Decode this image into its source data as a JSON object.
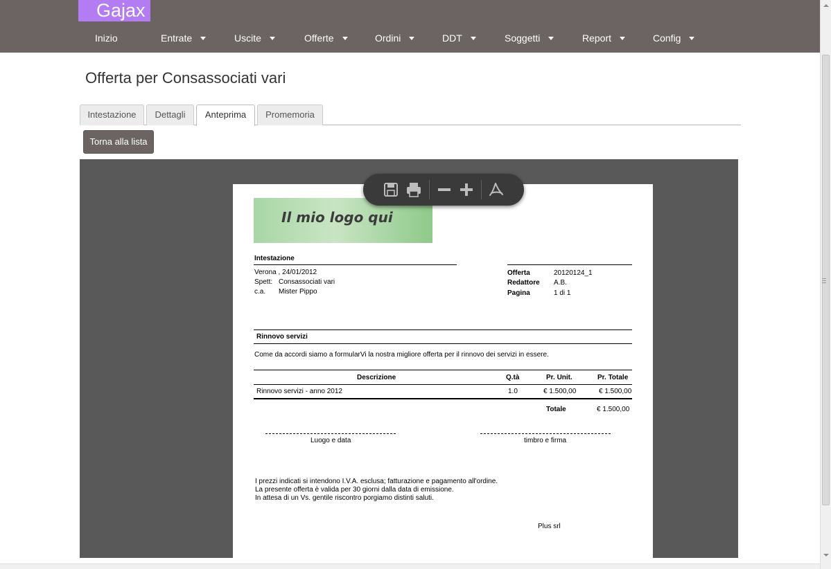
{
  "app": {
    "brand": "Gajax"
  },
  "nav": {
    "items": [
      {
        "label": "Inizio",
        "caret": false
      },
      {
        "label": "Entrate",
        "caret": true
      },
      {
        "label": "Uscite",
        "caret": true
      },
      {
        "label": "Offerte",
        "caret": true
      },
      {
        "label": "Ordini",
        "caret": true
      },
      {
        "label": "DDT",
        "caret": true
      },
      {
        "label": "Soggetti",
        "caret": true
      },
      {
        "label": "Report",
        "caret": true
      },
      {
        "label": "Config",
        "caret": true
      }
    ]
  },
  "page": {
    "title": "Offerta per Consassociati vari"
  },
  "tabs": [
    {
      "label": "Intestazione",
      "active": false
    },
    {
      "label": "Dettagli",
      "active": false
    },
    {
      "label": "Anteprima",
      "active": true
    },
    {
      "label": "Promemoria",
      "active": false
    }
  ],
  "actions": {
    "back_label": "Torna alla lista"
  },
  "viewer_toolbar": {
    "icons": [
      "save-icon",
      "print-icon",
      "zoom-out-icon",
      "zoom-in-icon",
      "acrobat-icon"
    ]
  },
  "document": {
    "logo_text": "Il mio logo qui",
    "header_title": "Intestazione",
    "place_date": "Verona , 24/01/2012",
    "spett_label": "Spett:",
    "spett_value": "Consassociati vari",
    "ca_label": "c.a.",
    "ca_value": "Mister Pippo",
    "meta": {
      "offerta_label": "Offerta",
      "offerta_value": "20120124_1",
      "redattore_label": "Redattore",
      "redattore_value": "A.B.",
      "pagina_label": "Pagina",
      "pagina_value": "1 di 1"
    },
    "subject": "Rinnovo servizi",
    "intro": "Come da accordi siamo a formularVi la nostra migliore offerta per il rinnovo dei servizi in essere.",
    "table": {
      "headers": {
        "descrizione": "Descrizione",
        "qta": "Q.tà",
        "pr_unit": "Pr. Unit.",
        "pr_totale": "Pr. Totale"
      },
      "rows": [
        {
          "descrizione": "Rinnovo servizi - anno 2012",
          "qta": "1.0",
          "pr_unit": "€ 1.500,00",
          "pr_totale": "€ 1.500,00"
        }
      ],
      "total_label": "Totale",
      "total_value": "€ 1.500,00"
    },
    "signature_left": "Luogo e data",
    "signature_right": "timbro e firma",
    "notes": [
      "I prezzi indicati si intendono I.V.A. esclusa; fatturazione e pagamento all'ordine.",
      "La presente offerta è valida per 30 giorni dalla data di emissione.",
      "In attesa di un Vs. gentile riscontro porgiamo distinti saluti."
    ],
    "company": "Plus srl"
  },
  "colors": {
    "header_bg": "#6b6462",
    "brand_bg": "#b37cf2",
    "viewer_bg": "#595959",
    "logo_green": "#a8d6a5"
  }
}
